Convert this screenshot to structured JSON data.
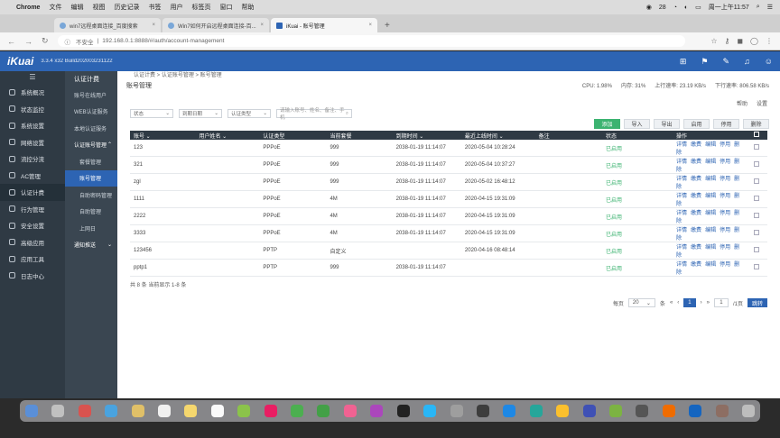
{
  "macbar": {
    "app": "Chrome",
    "menus": [
      "文件",
      "编辑",
      "视图",
      "历史记录",
      "书签",
      "用户",
      "标签页",
      "窗口",
      "帮助"
    ],
    "battery": "28",
    "clock": "周一上午11:57"
  },
  "browser": {
    "tabs": [
      {
        "title": "win7远程桌面连接_百度搜索"
      },
      {
        "title": "Win7如何开启远程桌面连接-百..."
      },
      {
        "title": "iKuai - 账号管理"
      }
    ],
    "url_warning": "不安全",
    "url": "192.168.0.1:8888/#/auth/account-management"
  },
  "header": {
    "logo": "iKuai",
    "version": "3.3.4 x32 Build202003231122"
  },
  "sidebar": {
    "items": [
      {
        "label": "系统概况"
      },
      {
        "label": "状态监控"
      },
      {
        "label": "系统设置"
      },
      {
        "label": "网络设置"
      },
      {
        "label": "流控分流"
      },
      {
        "label": "AC管理"
      },
      {
        "label": "认证计费"
      },
      {
        "label": "行为管理"
      },
      {
        "label": "安全设置"
      },
      {
        "label": "高级应用"
      },
      {
        "label": "应用工具"
      },
      {
        "label": "日志中心"
      }
    ]
  },
  "subnav": {
    "title": "认证计费",
    "items": [
      {
        "label": "账号在线用户"
      },
      {
        "label": "WEB认证服务"
      },
      {
        "label": "本地认证服务"
      },
      {
        "label": "认证账号管理"
      },
      {
        "label": "套餐管理"
      },
      {
        "label": "账号管理"
      },
      {
        "label": "自助密码管理"
      },
      {
        "label": "自助管理"
      },
      {
        "label": "上网日"
      },
      {
        "label": "通知推送"
      }
    ]
  },
  "page": {
    "breadcrumb": "认证计费 > 认证账号管理 > 账号管理",
    "title": "账号管理",
    "stats": {
      "cpu": "CPU: 1.98%",
      "mem": "内存: 31%",
      "up": "上行速率: 23.19 KB/s",
      "down": "下行速率: 806.58 KB/s"
    },
    "links": {
      "help": "帮助",
      "settings": "设置"
    },
    "filters": {
      "status": "状态",
      "expire": "到期日期",
      "auth_type": "认证类型",
      "search_placeholder": "请输入账号、姓名、备注、手机"
    },
    "actions": [
      "添加",
      "导入",
      "导出",
      "启用",
      "停用",
      "删除"
    ],
    "table": {
      "headers": [
        "账号",
        "用户姓名",
        "认证类型",
        "当前套餐",
        "到期时间",
        "最近上线时间",
        "备注",
        "状态",
        "操作"
      ],
      "rows": [
        {
          "account": "123",
          "name": "",
          "type": "PPPoE",
          "pkg": "999",
          "expire": "2038-01-19 11:14:07",
          "last": "2020-05-04 10:28:24",
          "note": "",
          "status": "已启用"
        },
        {
          "account": "321",
          "name": "",
          "type": "PPPoE",
          "pkg": "999",
          "expire": "2038-01-19 11:14:07",
          "last": "2020-05-04 10:37:27",
          "note": "",
          "status": "已启用"
        },
        {
          "account": "zgl",
          "name": "",
          "type": "PPPoE",
          "pkg": "999",
          "expire": "2038-01-19 11:14:07",
          "last": "2020-05-02 16:48:12",
          "note": "",
          "status": "已启用"
        },
        {
          "account": "1111",
          "name": "",
          "type": "PPPoE",
          "pkg": "4M",
          "expire": "2038-01-19 11:14:07",
          "last": "2020-04-15 19:31:09",
          "note": "",
          "status": "已启用"
        },
        {
          "account": "2222",
          "name": "",
          "type": "PPPoE",
          "pkg": "4M",
          "expire": "2038-01-19 11:14:07",
          "last": "2020-04-15 19:31:09",
          "note": "",
          "status": "已启用"
        },
        {
          "account": "3333",
          "name": "",
          "type": "PPPoE",
          "pkg": "4M",
          "expire": "2038-01-19 11:14:07",
          "last": "2020-04-15 19:31:09",
          "note": "",
          "status": "已启用"
        },
        {
          "account": "123456",
          "name": "",
          "type": "PPTP",
          "pkg": "自定义",
          "expire": "",
          "last": "2020-04-16 08:48:14",
          "note": "",
          "status": "已启用"
        },
        {
          "account": "pptp1",
          "name": "",
          "type": "PPTP",
          "pkg": "999",
          "expire": "2038-01-19 11:14:07",
          "last": "",
          "note": "",
          "status": "已启用"
        }
      ],
      "ops": [
        "详情",
        "缴费",
        "编辑",
        "停用",
        "删除"
      ]
    },
    "total": "共 8 条 当前显示 1-8 条",
    "pager": {
      "per_page_label": "每页",
      "per_page": "20",
      "unit": "条",
      "current": "1",
      "jump_value": "1",
      "total_pages": "/1页",
      "go": "跳转"
    }
  },
  "colors": {
    "brand": "#2d64b3",
    "enabled": "#3cb371",
    "sidebar": "#2f3a44"
  }
}
